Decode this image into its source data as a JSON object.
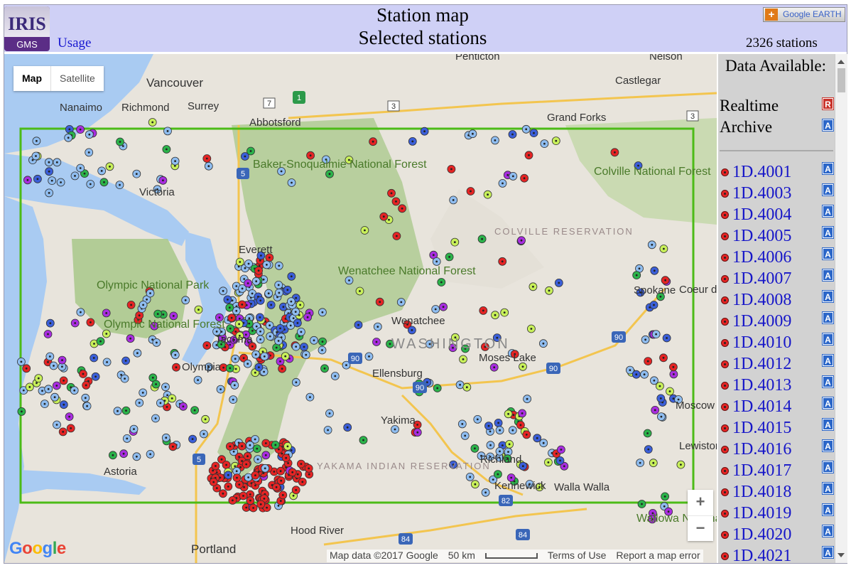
{
  "header": {
    "logo_top": "IRIS",
    "logo_bottom": "GMS",
    "usage_link": "Usage",
    "title_line1": "Station map",
    "title_line2": "Selected stations",
    "google_earth_button": "Google EARTH",
    "station_count": "2326 stations"
  },
  "map": {
    "map_type": [
      "Map",
      "Satellite"
    ],
    "selected_map_type": "Map",
    "zoom_in": "+",
    "zoom_out": "−",
    "google_logo": "Google",
    "attribution": "Map data ©2017 Google",
    "scale_label": "50 km",
    "terms": "Terms of Use",
    "report": "Report a map error",
    "selection_box_color": "#4cbb17",
    "labels": {
      "vancouver": "Vancouver",
      "nanaimo": "Nanaimo",
      "richmond": "Richmond",
      "surrey": "Surrey",
      "abbotsford": "Abbotsford",
      "victoria": "Victoria",
      "everett": "Everett",
      "olympia": "Olympia",
      "tacoma": "Tacoma",
      "olympic_np": "Olympic National Park",
      "olympic_nf": "Olympic National Forest",
      "baker": "Baker-Snoqualmie National Forest",
      "wenatchee_nf": "Wenatchee National Forest",
      "wenatchee": "Wenatchee",
      "washington": "WASHINGTON",
      "moses_lake": "Moses Lake",
      "ellensburg": "Ellensburg",
      "yakima": "Yakima",
      "yakama": "YAKAMA INDIAN RESERVATION",
      "colville_nf": "Colville National Forest",
      "colville_res": "COLVILLE RESERVATION",
      "castlegar": "Castlegar",
      "nelson": "Nelson",
      "penticton": "Penticton",
      "grand_forks": "Grand Forks",
      "spokane": "Spokane",
      "coeur": "Coeur d'",
      "moscow": "Moscow",
      "lewiston": "Lewiston",
      "richland": "Richland",
      "kennewick": "Kennewick",
      "walla_walla": "Walla Walla",
      "wallowa": "Wallowa National",
      "astoria": "Astoria",
      "hood_river": "Hood River",
      "portland": "Portland",
      "hwy_5": "5",
      "hwy_90": "90",
      "hwy_82": "82",
      "hwy_84": "84",
      "hwy_3": "3",
      "hwy_7": "7",
      "hwy_1": "1"
    }
  },
  "sidebar": {
    "data_available": "Data Available:",
    "realtime_label": "Realtime",
    "archive_label": "Archive",
    "realtime_badge": "R",
    "archive_badge": "A",
    "stations": [
      "1D.4001",
      "1D.4003",
      "1D.4004",
      "1D.4005",
      "1D.4006",
      "1D.4007",
      "1D.4008",
      "1D.4009",
      "1D.4010",
      "1D.4012",
      "1D.4013",
      "1D.4014",
      "1D.4015",
      "1D.4016",
      "1D.4017",
      "1D.4018",
      "1D.4019",
      "1D.4020",
      "1D.4021"
    ]
  }
}
